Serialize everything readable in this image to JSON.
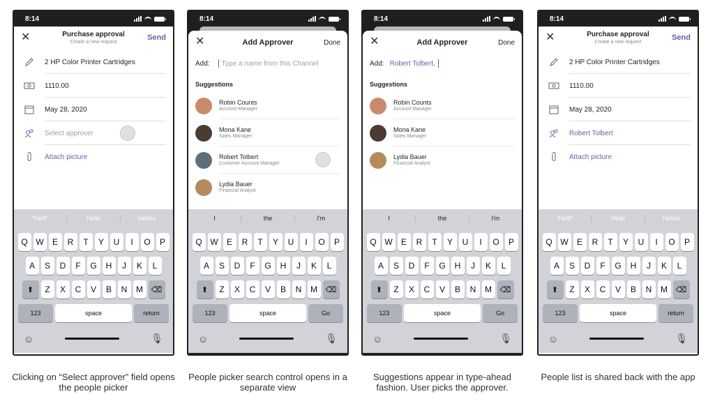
{
  "status_time": "8:14",
  "form": {
    "title": "Purchase approval",
    "subtitle": "Create a new request",
    "send": "Send",
    "item": "2 HP Color Printer Cartridges",
    "amount": "1110.00",
    "date": "May 28, 2020",
    "approver_placeholder": "Select approver",
    "approver_selected": "Robert Tolbert",
    "attach": "Attach picture"
  },
  "picker": {
    "title": "Add Approver",
    "done": "Done",
    "add_label": "Add:",
    "placeholder": "Type a name from this Channel",
    "typed": "Robert Tolbert,",
    "suggestions_label": "Suggestions"
  },
  "people_all": [
    {
      "name": "Robin Counts",
      "role": "Account Manager",
      "color": "#c98a6b"
    },
    {
      "name": "Mona Kane",
      "role": "Sales Manager",
      "color": "#4a3b33"
    },
    {
      "name": "Robert Tolbert",
      "role": "Customer Account Manager",
      "color": "#5e6f7c"
    },
    {
      "name": "Lydia Bauer",
      "role": "Financial Analyst",
      "color": "#b58a5c"
    }
  ],
  "people_filtered": [
    {
      "name": "Robin Counts",
      "role": "Account Manager",
      "color": "#c98a6b"
    },
    {
      "name": "Mona Kane",
      "role": "Sales Manager",
      "color": "#4a3b33"
    },
    {
      "name": "Lydia Bauer",
      "role": "Financial Analyst",
      "color": "#b58a5c"
    }
  ],
  "keyboard": {
    "predict_form": [
      "\"Helli\"",
      "Hello",
      "Hellos"
    ],
    "predict_picker": [
      "I",
      "the",
      "I'm"
    ],
    "row1": [
      "Q",
      "W",
      "E",
      "R",
      "T",
      "Y",
      "U",
      "I",
      "O",
      "P"
    ],
    "row2": [
      "A",
      "S",
      "D",
      "F",
      "G",
      "H",
      "J",
      "K",
      "L"
    ],
    "row3": [
      "Z",
      "X",
      "C",
      "V",
      "B",
      "N",
      "M"
    ],
    "num": "123",
    "space": "space",
    "return": "return",
    "go": "Go"
  },
  "captions": [
    "Clicking on “Select approver” field opens the people picker",
    "People picker search control opens in a separate view",
    "Suggestions appear in type-ahead fashion. User picks the approver.",
    "People list is shared back with the app"
  ]
}
